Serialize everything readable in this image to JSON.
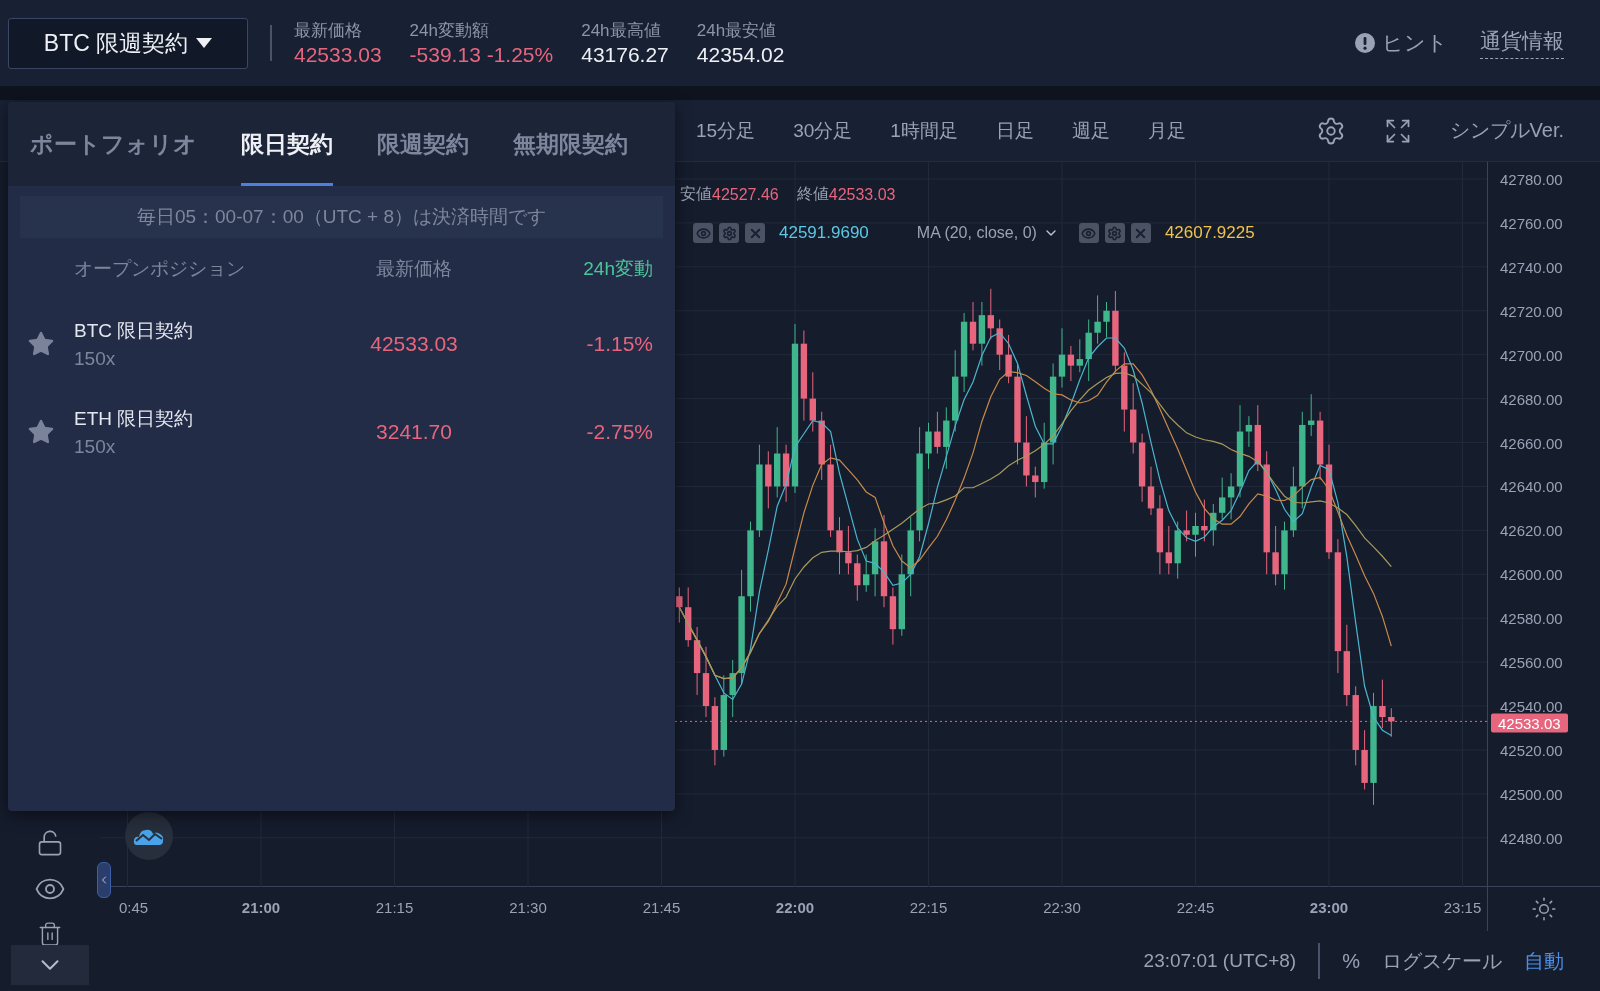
{
  "header": {
    "symbol": "BTC 限週契約",
    "stats": [
      {
        "label": "最新価格",
        "value": "42533.03",
        "color": "#e8657e"
      },
      {
        "label": "24h変動額",
        "value": "-539.13 -1.25%",
        "color": "#e8657e"
      },
      {
        "label": "24h最高値",
        "value": "43176.27",
        "color": "#eef0f5"
      },
      {
        "label": "24h最安値",
        "value": "42354.02",
        "color": "#eef0f5"
      }
    ],
    "hint": "ヒント",
    "info_link": "通貨情報"
  },
  "toolbar": {
    "intervals": [
      {
        "label": "15分足",
        "selected": false
      },
      {
        "label": "30分足",
        "selected": false
      },
      {
        "label": "1時間足",
        "selected": false
      },
      {
        "label": "日足",
        "selected": false
      },
      {
        "label": "週足",
        "selected": false
      },
      {
        "label": "月足",
        "selected": false
      }
    ],
    "simple_link": "シンプルVer."
  },
  "chart": {
    "legend": {
      "ohlc": [
        {
          "label": "安値",
          "value": "42527.46"
        },
        {
          "label": "終値",
          "value": "42533.03"
        }
      ],
      "indicators": [
        {
          "value": "42591.9690",
          "color": "#5bc8e6"
        },
        {
          "name": "MA (20, close, 0)",
          "value": "42607.9225",
          "color": "#f0c34a"
        }
      ]
    },
    "y_axis": [
      "42780.00",
      "42760.00",
      "42740.00",
      "42720.00",
      "42700.00",
      "42680.00",
      "42660.00",
      "42640.00",
      "42620.00",
      "42600.00",
      "42580.00",
      "42560.00",
      "42540.00",
      "42520.00",
      "42500.00",
      "42480.00"
    ],
    "x_axis": [
      {
        "label": "0:45",
        "major": false
      },
      {
        "label": "21:00",
        "major": true
      },
      {
        "label": "21:15",
        "major": false
      },
      {
        "label": "21:30",
        "major": false
      },
      {
        "label": "21:45",
        "major": false
      },
      {
        "label": "22:00",
        "major": true
      },
      {
        "label": "22:15",
        "major": false
      },
      {
        "label": "22:30",
        "major": false
      },
      {
        "label": "22:45",
        "major": false
      },
      {
        "label": "23:00",
        "major": true
      },
      {
        "label": "23:15",
        "major": false
      }
    ],
    "last_price": "42533.03"
  },
  "footer": {
    "time": "23:07:01 (UTC+8)",
    "scale_options": [
      {
        "label": "%",
        "selected": false
      },
      {
        "label": "ログスケール",
        "selected": false
      },
      {
        "label": "自動",
        "selected": true
      }
    ]
  },
  "panel": {
    "tabs": [
      {
        "label": "ポートフォリオ",
        "selected": false
      },
      {
        "label": "限日契約",
        "selected": true
      },
      {
        "label": "限週契約",
        "selected": false
      },
      {
        "label": "無期限契約",
        "selected": false
      }
    ],
    "notice": "毎日05：00-07：00（UTC + 8）は決済時間です",
    "columns": [
      {
        "label": "オープンポジション",
        "highlighted": false
      },
      {
        "label": "最新価格",
        "highlighted": false
      },
      {
        "label": "24h変動",
        "highlighted": true
      }
    ],
    "rows": [
      {
        "name": "BTC 限日契約",
        "leverage": "150x",
        "price": "42533.03",
        "change": "-1.15%"
      },
      {
        "name": "ETH 限日契約",
        "leverage": "150x",
        "price": "3241.70",
        "change": "-2.75%"
      }
    ]
  }
}
